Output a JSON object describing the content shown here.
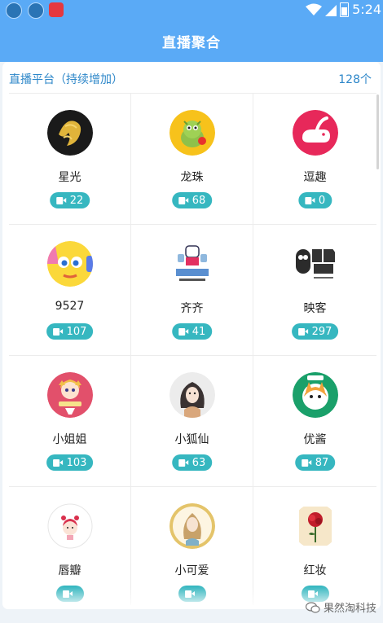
{
  "status_bar": {
    "time": "5:24",
    "icons": [
      "app-icon",
      "app-icon",
      "app-icon",
      "wifi-icon",
      "signal-icon",
      "battery-icon"
    ]
  },
  "header": {
    "title": "直播聚合"
  },
  "section": {
    "title": "直播平台（持续增加）",
    "count": "128个"
  },
  "platforms": [
    {
      "name": "星光",
      "viewers": "22"
    },
    {
      "name": "龙珠",
      "viewers": "68"
    },
    {
      "name": "逗趣",
      "viewers": "0"
    },
    {
      "name": "9527",
      "viewers": "107"
    },
    {
      "name": "齐齐",
      "viewers": "41"
    },
    {
      "name": "映客",
      "viewers": "297"
    },
    {
      "name": "小姐姐",
      "viewers": "103"
    },
    {
      "name": "小狐仙",
      "viewers": "63"
    },
    {
      "name": "优酱",
      "viewers": "87"
    },
    {
      "name": "唇瓣",
      "viewers": ""
    },
    {
      "name": "小可爱",
      "viewers": ""
    },
    {
      "name": "红妆",
      "viewers": ""
    }
  ],
  "watermark": "果然淘科技",
  "colors": {
    "header": "#5aaaf6",
    "accent_text": "#2d87c9",
    "badge": "#36b7c0"
  }
}
